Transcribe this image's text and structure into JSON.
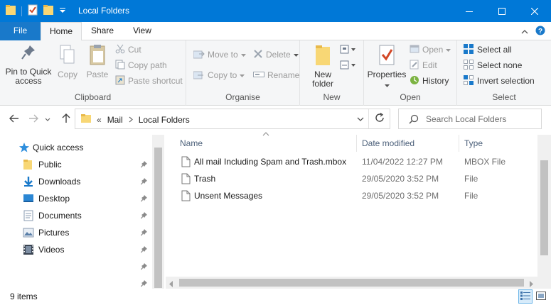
{
  "window": {
    "title": "Local Folders",
    "accent": "#0078d7"
  },
  "tabs": {
    "file": "File",
    "home": "Home",
    "share": "Share",
    "view": "View"
  },
  "ribbon": {
    "clipboard": {
      "pin_to_quick_access": "Pin to Quick access",
      "copy": "Copy",
      "paste": "Paste",
      "cut": "Cut",
      "copy_path": "Copy path",
      "paste_shortcut": "Paste shortcut",
      "label": "Clipboard"
    },
    "organise": {
      "move_to": "Move to",
      "copy_to": "Copy to",
      "delete": "Delete",
      "rename": "Rename",
      "label": "Organise"
    },
    "new": {
      "new_folder_line1": "New",
      "new_folder_line2": "folder",
      "label": "New"
    },
    "open": {
      "properties": "Properties",
      "open": "Open",
      "edit": "Edit",
      "history": "History",
      "label": "Open"
    },
    "select": {
      "select_all": "Select all",
      "select_none": "Select none",
      "invert_selection": "Invert selection",
      "label": "Select"
    }
  },
  "address": {
    "overflow": "«",
    "crumbs": [
      "Mail",
      "Local Folders"
    ]
  },
  "search": {
    "placeholder": "Search Local Folders"
  },
  "nav": {
    "quick_access": "Quick access",
    "items": [
      {
        "label": "Public",
        "icon": "folder-icon"
      },
      {
        "label": "Downloads",
        "icon": "download-icon"
      },
      {
        "label": "Desktop",
        "icon": "desktop-icon"
      },
      {
        "label": "Documents",
        "icon": "documents-icon"
      },
      {
        "label": "Pictures",
        "icon": "pictures-icon"
      },
      {
        "label": "Videos",
        "icon": "videos-icon"
      }
    ]
  },
  "columns": {
    "name": "Name",
    "date_modified": "Date modified",
    "type": "Type"
  },
  "files": [
    {
      "name": "All mail Including Spam and Trash.mbox",
      "date": "11/04/2022 12:27 PM",
      "type": "MBOX File"
    },
    {
      "name": "Trash",
      "date": "29/05/2020 3:52 PM",
      "type": "File"
    },
    {
      "name": "Unsent Messages",
      "date": "29/05/2020 3:52 PM",
      "type": "File"
    }
  ],
  "status": {
    "item_count": "9 items"
  }
}
